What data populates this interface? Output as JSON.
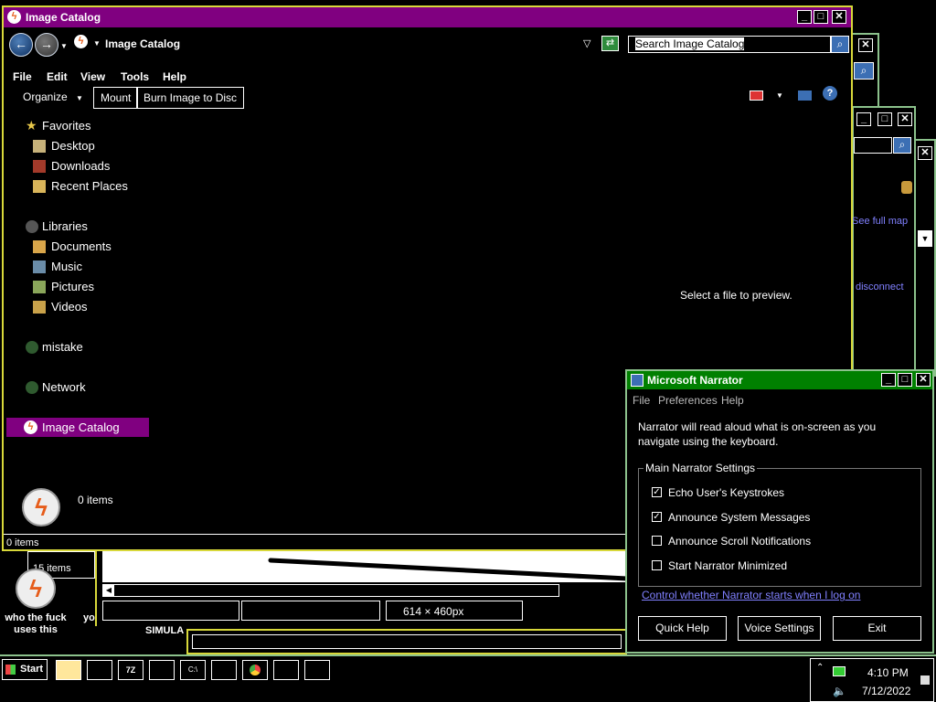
{
  "explorer": {
    "title": "Image Catalog",
    "address": "Image Catalog",
    "search_placeholder": "Search Image Catalog",
    "menu": [
      "File",
      "Edit",
      "View",
      "Tools",
      "Help"
    ],
    "organize": "Organize",
    "mount": "Mount",
    "burn": "Burn Image to Disc",
    "nav": {
      "favorites": "Favorites",
      "desktop": "Desktop",
      "downloads": "Downloads",
      "recent": "Recent Places",
      "libraries": "Libraries",
      "documents": "Documents",
      "music": "Music",
      "pictures": "Pictures",
      "videos": "Videos",
      "mistake": "mistake",
      "network": "Network",
      "image_catalog": "Image Catalog"
    },
    "preview": "Select a file to preview.",
    "item_count": "0 items",
    "status": "0 items"
  },
  "background": {
    "see_full_map": "See full map",
    "disconnect": "disconnect",
    "items_15": "15 items",
    "dimensions": "614 × 460px",
    "simula": "SIMULA",
    "desktop_icon_label": "who the fuck uses this",
    "yo": "yo"
  },
  "narrator": {
    "title": "Microsoft Narrator",
    "menu": [
      "File",
      "Preferences",
      "Help"
    ],
    "description": "Narrator will read aloud what is on-screen as you navigate using the keyboard.",
    "group": "Main Narrator Settings",
    "options": [
      {
        "label": "Echo User's Keystrokes",
        "checked": true
      },
      {
        "label": "Announce System Messages",
        "checked": true
      },
      {
        "label": "Announce Scroll Notifications",
        "checked": false
      },
      {
        "label": "Start Narrator Minimized",
        "checked": false
      }
    ],
    "link": "Control whether Narrator starts when I log on",
    "buttons": [
      "Quick Help",
      "Voice Settings",
      "Exit"
    ]
  },
  "taskbar": {
    "start": "Start",
    "time": "4:10 PM",
    "date": "7/12/2022"
  },
  "colors": {
    "explorer_title": "#800080",
    "narrator_title": "#008000",
    "window_border": "#d8d83a",
    "link": "#8080ff"
  }
}
